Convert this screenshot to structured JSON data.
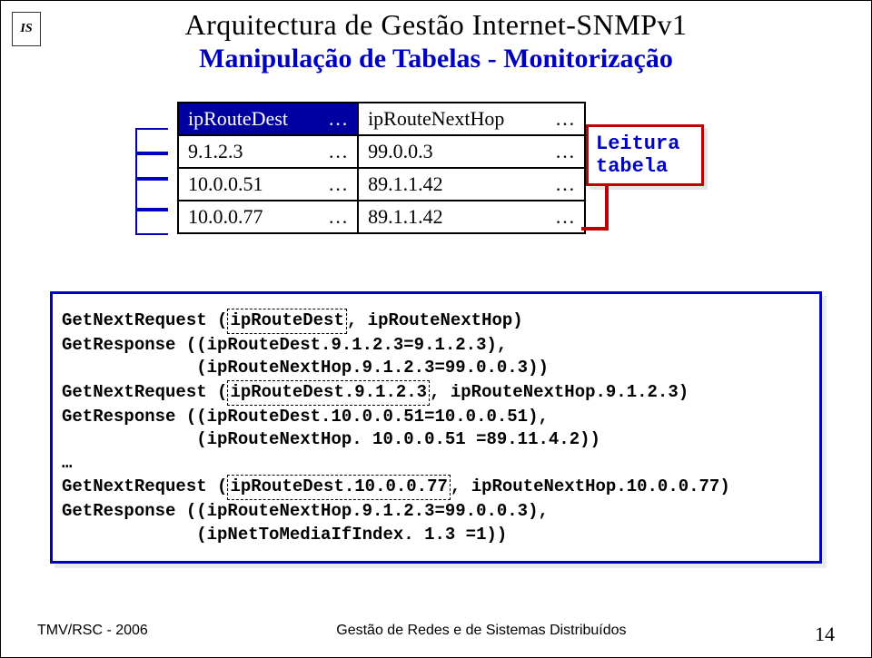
{
  "logo": "IS",
  "title1": "Arquitectura de Gestão Internet-SNMPv1",
  "title2": "Manipulação de Tabelas - Monitorização",
  "table": {
    "h1": "ipRouteDest",
    "h2": "ipRouteNextHop",
    "rows": [
      {
        "c1a": "9.1.2.3",
        "c1b": "…",
        "c2a": "99.0.0.3",
        "c2b": "…"
      },
      {
        "c1a": "10.0.0.51",
        "c1b": "…",
        "c2a": "89.1.1.42",
        "c2b": "…"
      },
      {
        "c1a": "10.0.0.77",
        "c1b": "…",
        "c2a": "89.1.1.42",
        "c2b": "…"
      }
    ]
  },
  "label": {
    "l1": "Leitura",
    "l2": "tabela"
  },
  "code": {
    "l1a": "GetNextRequest (",
    "l1b": "ipRouteDest",
    "l1c": ", ipRouteNextHop)",
    "l2": "GetResponse ((ipRouteDest.9.1.2.3=9.1.2.3),",
    "l3": "             (ipRouteNextHop.9.1.2.3=99.0.0.3))",
    "l4a": "GetNextRequest (",
    "l4b": "ipRouteDest.9.1.2.3",
    "l4c": ", ipRouteNextHop.9.1.2.3)",
    "l5": "GetResponse ((ipRouteDest.10.0.0.51=10.0.0.51),",
    "l6": "             (ipRouteNextHop. 10.0.0.51 =89.11.4.2))",
    "l7": "…",
    "l8a": "GetNextRequest (",
    "l8b": "ipRouteDest.10.0.0.77",
    "l8c": ", ipRouteNextHop.10.0.0.77)",
    "l9": "GetResponse ((ipRouteNextHop.9.1.2.3=99.0.0.3),",
    "l10": "             (ipNetToMediaIfIndex. 1.3 =1))"
  },
  "footer": {
    "left": "TMV/RSC - 2006",
    "center": "Gestão de Redes e de Sistemas Distribuídos",
    "page": "14"
  }
}
